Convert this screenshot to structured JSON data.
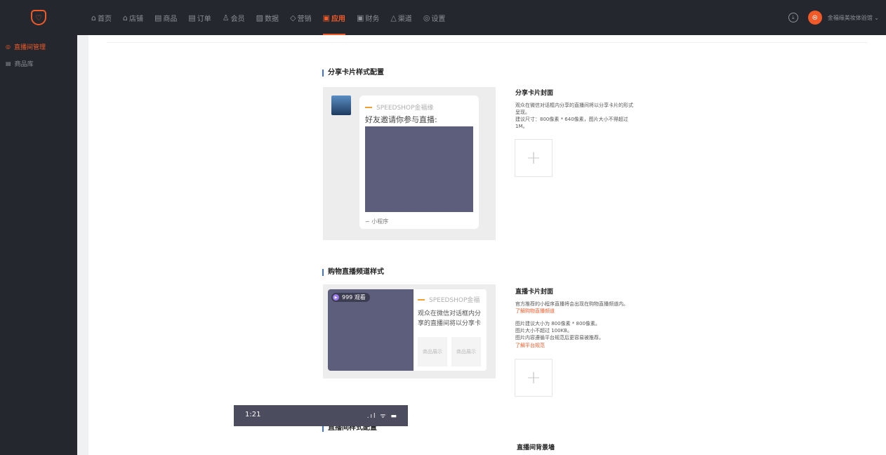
{
  "nav": {
    "items": [
      {
        "icon": "⌂",
        "label": "首页"
      },
      {
        "icon": "⌂",
        "label": "店铺"
      },
      {
        "icon": "▤",
        "label": "商品"
      },
      {
        "icon": "▤",
        "label": "订单"
      },
      {
        "icon": "♙",
        "label": "会员"
      },
      {
        "icon": "▨",
        "label": "数据"
      },
      {
        "icon": "◇",
        "label": "营销"
      },
      {
        "icon": "▣",
        "label": "应用"
      },
      {
        "icon": "▣",
        "label": "财务"
      },
      {
        "icon": "△",
        "label": "渠道"
      },
      {
        "icon": "◎",
        "label": "设置"
      }
    ],
    "active_index": 7,
    "user_initial": "⊜",
    "user_name": "金福缘美妆体验馆 ⌄",
    "accent": "#f05a28"
  },
  "sidebar": {
    "items": [
      {
        "icon": "◎",
        "label": "直播间管理",
        "active": true
      },
      {
        "icon": "▤",
        "label": "商品库",
        "active": false
      }
    ]
  },
  "share_section": {
    "title": "分享卡片样式配置",
    "card": {
      "brand": "SPEEDSHOP金福缘",
      "title": "好友邀请你参与直播:",
      "footer": "∽ 小程序"
    },
    "desc_title": "分享卡片封面",
    "desc_lines": [
      "观众在微信对话框内分享的直播间将以分享卡片的形式",
      "呈现。",
      "建议尺寸：800像素 * 640像素，图片大小不得超过",
      "1M。"
    ],
    "upload_plus": "+"
  },
  "channel_section": {
    "title": "购物直播频道样式",
    "card": {
      "badge": "999 观看",
      "brand": "SPEEDSHOP金福",
      "text": "观众在微信对话框内分享的直播间将以分享卡",
      "prod1": "商品展示",
      "prod2": "商品展示"
    },
    "desc_title": "直播卡片封面",
    "desc_line1": "官方推荐的小程序直播将会出现在购物直播频道内。",
    "link1": "了解购物直播频道",
    "desc_lines2": [
      "图片建议大小为 800像素 * 800像素。",
      "图片大小不超过 100KB。",
      "图片内容遵循平台规范后更容易被推荐。"
    ],
    "link2": "了解平台规范",
    "upload_plus": "+"
  },
  "room_section": {
    "title": "直播间样式配置",
    "phone_time": "1:21",
    "phone_status": ".ıl ᯤ ▬",
    "desc_title": "直播间背景墙"
  }
}
